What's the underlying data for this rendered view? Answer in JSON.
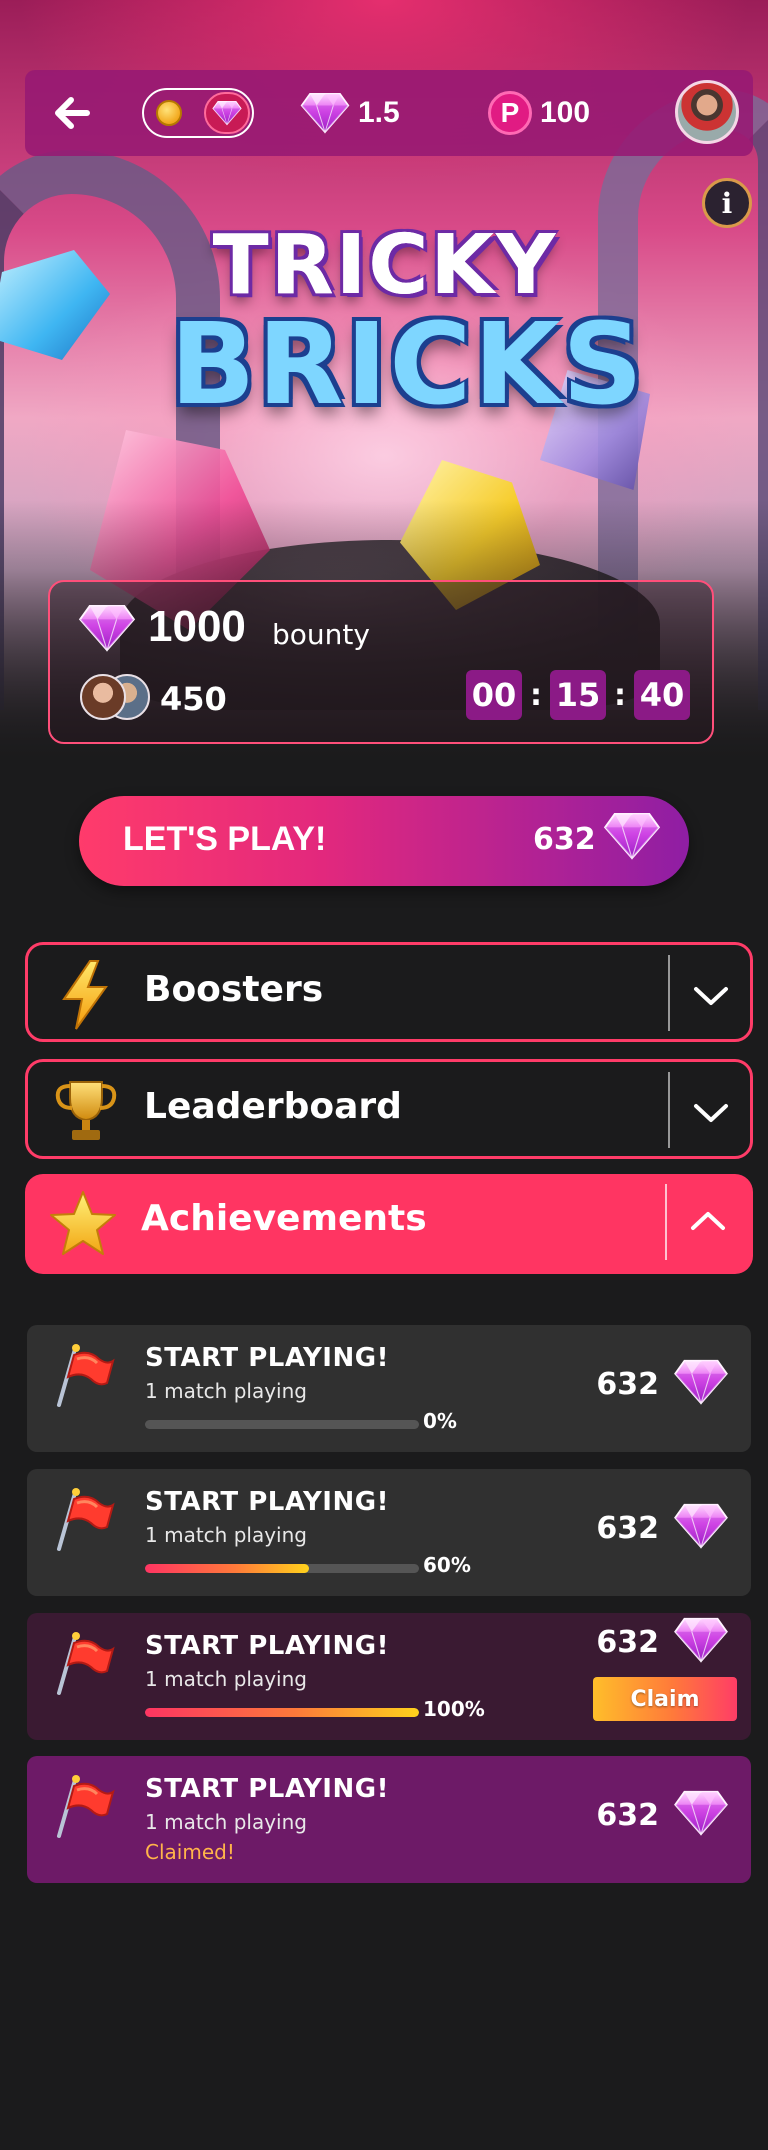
{
  "header": {
    "gem_balance": "1.5",
    "token_balance": "100",
    "token_glyph": "P",
    "coin_glyph": "z",
    "info_glyph": "i"
  },
  "game": {
    "logo_line1": "TRICKY",
    "logo_line2": "BRICKS"
  },
  "bounty": {
    "amount": "1000",
    "label": "bounty",
    "player_count": "450",
    "timer": {
      "hours": "00",
      "minutes": "15",
      "seconds": "40",
      "separator": ":"
    }
  },
  "play": {
    "label": "LET'S PLAY!",
    "cost": "632"
  },
  "sections": [
    {
      "title": "Boosters",
      "icon": "lightning-icon",
      "expanded": false
    },
    {
      "title": "Leaderboard",
      "icon": "trophy-icon",
      "expanded": false
    },
    {
      "title": "Achievements",
      "icon": "star-icon",
      "expanded": true
    }
  ],
  "achievements": [
    {
      "title": "START PLAYING!",
      "subtitle": "1 match playing",
      "progress": 0,
      "progress_label": "0%",
      "reward": "632",
      "state": "in-progress"
    },
    {
      "title": "START PLAYING!",
      "subtitle": "1 match playing",
      "progress": 0.6,
      "progress_label": "60%",
      "reward": "632",
      "state": "in-progress"
    },
    {
      "title": "START PLAYING!",
      "subtitle": "1 match playing",
      "progress": 1.0,
      "progress_label": "100%",
      "reward": "632",
      "state": "claimable",
      "claim_label": "Claim"
    },
    {
      "title": "START PLAYING!",
      "subtitle": "1 match playing",
      "reward": "632",
      "state": "claimed",
      "status_label": "Claimed!"
    }
  ],
  "colors": {
    "accent": "#ff3562",
    "topbar": "#96197380",
    "gem": "#d946ef",
    "timer_box": "#8b1a86",
    "claimed_bg": "#6d1a67",
    "claimed_text": "#ffb44a"
  }
}
